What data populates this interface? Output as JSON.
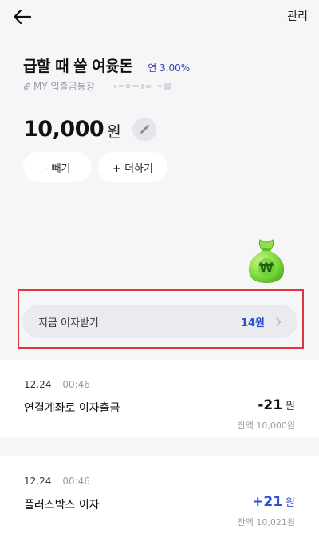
{
  "header": {
    "back_icon": "arrow-left-icon",
    "manage_label": "관리"
  },
  "account": {
    "title": "급할 때 쓸 여윳돈",
    "rate": "연 3.00%",
    "linked_label": "MY 입출금통장",
    "link_icon": "link-icon",
    "balance": "10,000",
    "currency": "원",
    "edit_icon": "pencil-icon"
  },
  "actions": {
    "withdraw_label": "- 빼기",
    "deposit_label": "+ 더하기"
  },
  "interest": {
    "label": "지금 이자받기",
    "amount": "14원",
    "icon": "money-bag-icon",
    "highlight_color": "#e0353b"
  },
  "transactions": [
    {
      "date": "12.24",
      "time": "00:46",
      "title": "연결계좌로 이자출금",
      "amount": "-21",
      "currency": "원",
      "balance": "잔액 10,000원"
    },
    {
      "date": "12.24",
      "time": "00:46",
      "title": "플러스박스 이자",
      "amount": "+21",
      "currency": "원",
      "balance": "잔액 10,021원"
    }
  ],
  "colors": {
    "accent_blue": "#2d4ed8",
    "rate_purple": "#3b3fb4",
    "background": "#f6f6f8"
  }
}
